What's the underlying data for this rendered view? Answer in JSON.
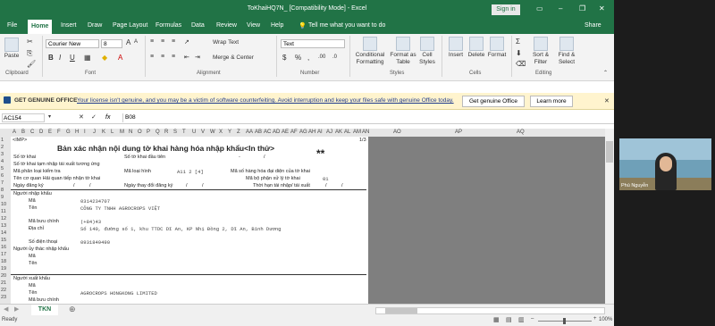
{
  "window": {
    "title": "ToKhaiHQ7N_ [Compatibility Mode] - Excel",
    "signin": "Sign in"
  },
  "ribbon_tabs": [
    "File",
    "Home",
    "Insert",
    "Draw",
    "Page Layout",
    "Formulas",
    "Data",
    "Review",
    "View",
    "Help"
  ],
  "tell_me": "Tell me what you want to do",
  "share": "Share",
  "ribbon": {
    "paste": "Paste",
    "clipboard": "Clipboard",
    "font_name": "Courier New",
    "font_size": "8",
    "font_group": "Font",
    "wrap_text": "Wrap Text",
    "merge_center": "Merge & Center",
    "alignment": "Alignment",
    "number_format": "Text",
    "number_group": "Number",
    "conditional": "Conditional Formatting",
    "format_table": "Format as Table",
    "cell_styles": "Cell Styles",
    "styles_group": "Styles",
    "insert": "Insert",
    "delete": "Delete",
    "format": "Format",
    "cells_group": "Cells",
    "sort_filter": "Sort & Filter",
    "find_select": "Find & Select",
    "editing_group": "Editing"
  },
  "warning": {
    "title": "GET GENUINE OFFICE",
    "text": "Your license isn't genuine, and you may be a victim of software counterfeiting. Avoid interruption and keep your files safe with genuine Office today.",
    "btn1": "Get genuine Office",
    "btn2": "Learn more"
  },
  "formula": {
    "namebox": "AC154",
    "fx": "fx",
    "value": "B08"
  },
  "columns": [
    "A",
    "B",
    "C",
    "D",
    "E",
    "F",
    "G",
    "H",
    "I",
    "J",
    "K",
    "L",
    "M",
    "N",
    "O",
    "P",
    "Q",
    "R",
    "S",
    "T",
    "U",
    "V",
    "W",
    "X",
    "Y",
    "Z",
    "AA",
    "AB",
    "AC",
    "AD",
    "AE",
    "AF",
    "AG",
    "AH",
    "AI",
    "AJ",
    "AK",
    "AL",
    "AM",
    "AN",
    "AO",
    "AP",
    "AQ"
  ],
  "rows": [
    "1",
    "2",
    "3",
    "4",
    "5",
    "6",
    "7",
    "8",
    "9",
    "10",
    "11",
    "12",
    "13",
    "14",
    "15",
    "16",
    "17",
    "18",
    "19",
    "20",
    "21",
    "22",
    "23"
  ],
  "doc": {
    "imp": "<IMP>",
    "page": "1/3",
    "heading": "Bản xác nhận nội dung tờ khai hàng hóa nhập khẩu<In thử>",
    "stars": "**",
    "so_to_khai": "Số tờ khai",
    "so_to_khai_dau_tien": "Số tờ khai đầu tiên",
    "tam_nhap": "Số tờ khai tạm nhập tái xuất tương ứng",
    "ma_phan_loai": "Mã phân loại kiểm tra",
    "ma_loai_hinh": "Mã loại hình",
    "loai_hinh_val": "A11  2 [4]",
    "ma_so_hang_hoa": "Mã số hàng hóa đại diện của tờ khai",
    "ten_co_quan": "Tên cơ quan Hải quan tiếp nhận tờ khai",
    "ma_bo_phan": "Mã bộ phận xử lý tờ khai",
    "ma_bo_phan_val": "01",
    "ngay_dang_ky": "Ngày đăng ký",
    "ngay_thay_doi": "Ngày thay đổi đăng ký",
    "thoi_han": "Thời hạn tái nhập/ tái xuất",
    "slash": "/",
    "dash": "-",
    "nguoi_nhap_khau": "Người nhập khẩu",
    "ma": "Mã",
    "ten": "Tên",
    "ma_buu_chinh": "Mã bưu chính",
    "dia_chi": "Địa chỉ",
    "so_dien_thoai": "Số điện thoại",
    "nguoi_uy_thac": "Người ủy thác nhập khẩu",
    "nguoi_xuat_khau": "Người xuất khẩu",
    "importer_code": "0314234707",
    "importer_name": "CÔNG TY TNHH AGROCROPS VIỆT",
    "postal": "(+84)43",
    "address": "Số 140, đường số 1, khu TTDC Dĩ An, KP Nhị Đồng 2, Dĩ An, Bình Dương",
    "phone": "0931849490",
    "exporter_name": "AGROCROPS HONGKONG LIMITED"
  },
  "sheet_tab": "TKN",
  "status": {
    "ready": "Ready",
    "zoom": "100%"
  },
  "video": {
    "name": "Phú Nguyễn"
  },
  "colors": {
    "excel_green": "#217346",
    "warning_bg": "#fff4ce",
    "gray": "#7f7f7f"
  }
}
